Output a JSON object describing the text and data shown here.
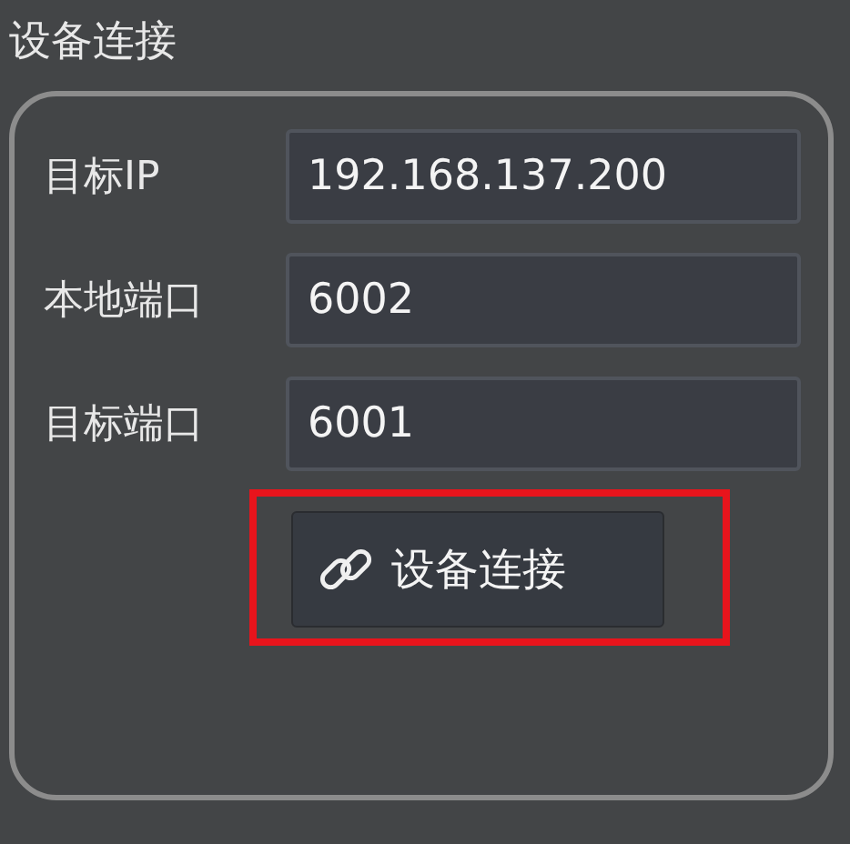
{
  "title": "设备连接",
  "fields": [
    {
      "label": "目标IP",
      "value": "192.168.137.200"
    },
    {
      "label": "本地端口",
      "value": "6002"
    },
    {
      "label": "目标端口",
      "value": "6001"
    }
  ],
  "button": {
    "label": "设备连接",
    "highlighted": true
  }
}
